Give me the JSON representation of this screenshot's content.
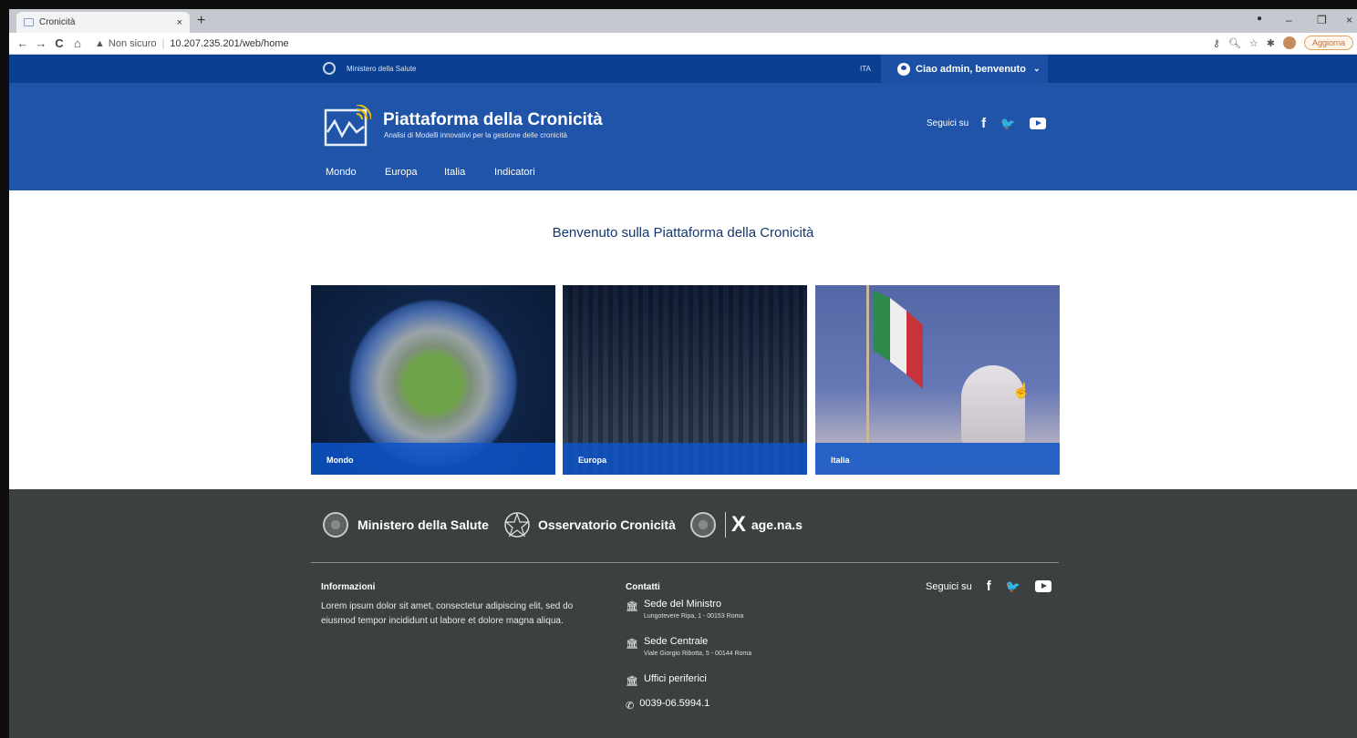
{
  "browser": {
    "tab_title": "Cronicità",
    "tab_close": "×",
    "new_tab": "+",
    "nav": {
      "back": "←",
      "forward": "→",
      "reload": "C",
      "home": "⌂"
    },
    "security_label": "Non sicuro",
    "separator": "|",
    "url": "10.207.235.201/web/home",
    "update_label": "Aggiorna",
    "window_controls": {
      "minimize": "–",
      "restore": "❐",
      "close": "×"
    }
  },
  "slim_header": {
    "ministry": "Ministero della Salute",
    "language": "ITA",
    "user_greeting": "Ciao admin, benvenuto",
    "chevron": "⌄"
  },
  "header": {
    "title": "Piattaforma della Cronicità",
    "subtitle": "Analisi di Modelli innovativi per la gestione delle cronicità",
    "social_label": "Seguici su",
    "facebook": "f",
    "twitter": "🐦"
  },
  "nav": {
    "items": [
      "Mondo",
      "Europa",
      "Italia",
      "Indicatori"
    ]
  },
  "main": {
    "welcome": "Benvenuto sulla Piattaforma della Cronicità",
    "cards": [
      {
        "label": "Mondo"
      },
      {
        "label": "Europa"
      },
      {
        "label": "Italia"
      }
    ]
  },
  "footer": {
    "logos": [
      "Ministero della Salute",
      "Osservatorio Cronicità",
      "age.na.s"
    ],
    "agenas_mark": "X",
    "info": {
      "title": "Informazioni",
      "text": "Lorem ipsum dolor sit amet, consectetur adipiscing elit, sed do eiusmod tempor incididunt ut labore et dolore magna aliqua."
    },
    "contacts": {
      "title": "Contatti",
      "items": [
        {
          "name": "Sede del Ministro",
          "address": "Lungotevere Ripa, 1 - 00153 Roma"
        },
        {
          "name": "Sede Centrale",
          "address": "Viale Giorgio Ribotta, 5 - 00144 Roma"
        },
        {
          "name": "Uffici periferici",
          "address": ""
        }
      ],
      "phone": "0039-06.5994.1"
    },
    "social_label": "Seguici su",
    "facebook": "f",
    "twitter": "🐦"
  },
  "colors": {
    "slim_header": "#0b3f91",
    "header": "#1f54a8",
    "footer": "#3b4040",
    "card_caption": "#0d54c8"
  }
}
